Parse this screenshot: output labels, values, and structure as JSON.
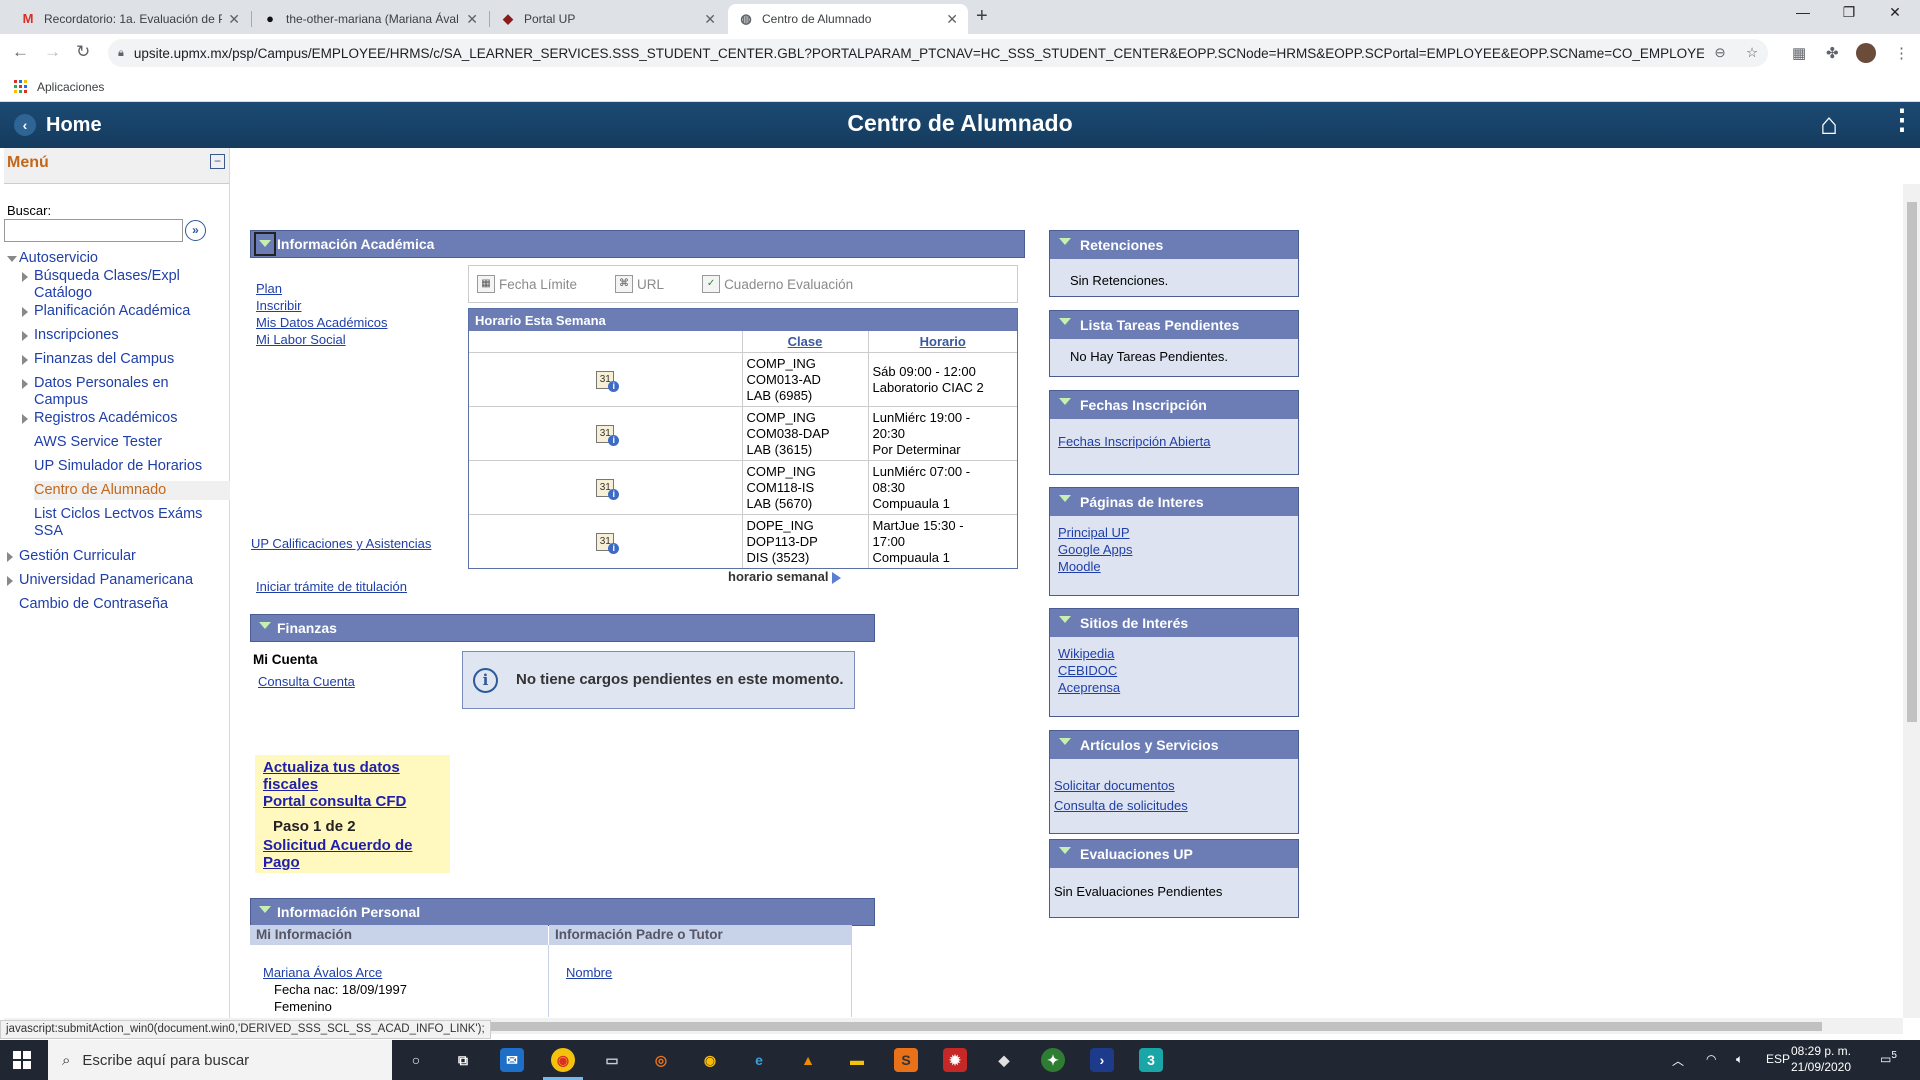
{
  "browser": {
    "tabs": [
      {
        "title": "Recordatorio: 1a. Evaluación de P",
        "favicon": "M"
      },
      {
        "title": "the-other-mariana (Mariana Ával",
        "favicon": "gh"
      },
      {
        "title": "Portal UP",
        "favicon": "up"
      },
      {
        "title": "Centro de Alumnado",
        "favicon": "globe"
      }
    ],
    "url": "upsite.upmx.mx/psp/Campus/EMPLOYEE/HRMS/c/SA_LEARNER_SERVICES.SSS_STUDENT_CENTER.GBL?PORTALPARAM_PTCNAV=HC_SSS_STUDENT_CENTER&EOPP.SCNode=HRMS&EOPP.SCPortal=EMPLOYEE&EOPP.SCName=CO_EMPLOYEE_SELF_SERV...",
    "bookmarks_label": "Aplicaciones"
  },
  "header": {
    "home_label": "Home",
    "title": "Centro de Alumnado"
  },
  "menu": {
    "title": "Menú",
    "search_label": "Buscar:",
    "autoservicio": "Autoservicio",
    "sub_items": [
      "Búsqueda Clases/Expl Catálogo",
      "Planificación Académica",
      "Inscripciones",
      "Finanzas del Campus",
      "Datos Personales en Campus",
      "Registros Académicos",
      "AWS Service Tester",
      "UP Simulador de Horarios",
      "Centro de Alumnado",
      "List Ciclos Lectvos Exáms SSA"
    ],
    "top_items": [
      "Gestión Curricular",
      "Universidad Panamericana",
      "Cambio de Contraseña"
    ]
  },
  "academica": {
    "title": "Información Académica",
    "links": [
      "Plan",
      "Inscribir",
      "Mis Datos Académicos",
      "Mi Labor Social"
    ],
    "calificaciones": "UP Calificaciones y Asistencias",
    "titulacion": "Iniciar trámite de titulación",
    "tools": [
      "Fecha Límite",
      "URL",
      "Cuaderno Evaluación"
    ],
    "schedule_title": "Horario Esta Semana",
    "col_clase": "Clase",
    "col_horario": "Horario",
    "rows": [
      {
        "clase": [
          "COMP_ING",
          "COM013-AD",
          "LAB (6985)"
        ],
        "horario": [
          "Sáb 09:00 - 12:00",
          "Laboratorio CIAC 2"
        ]
      },
      {
        "clase": [
          "COMP_ING",
          "COM038-DAP",
          "LAB (3615)"
        ],
        "horario": [
          "LunMiérc 19:00 -",
          "20:30",
          "Por Determinar"
        ]
      },
      {
        "clase": [
          "COMP_ING",
          "COM118-IS",
          "LAB (5670)"
        ],
        "horario": [
          "LunMiérc 07:00 -",
          "08:30",
          "Compuaula 1"
        ]
      },
      {
        "clase": [
          "DOPE_ING",
          "DOP113-DP",
          "DIS (3523)"
        ],
        "horario": [
          "MartJue 15:30 -",
          "17:00",
          "Compuaula 1"
        ]
      }
    ],
    "weekly_link": "horario semanal"
  },
  "finanzas": {
    "title": "Finanzas",
    "mi_cuenta": "Mi Cuenta",
    "consulta": "Consulta Cuenta",
    "message": "No tiene cargos pendientes en este momento."
  },
  "promo": {
    "actualiza": "Actualiza tus datos fiscales",
    "portal_cfd": "Portal consulta CFD",
    "paso": "Paso 1 de 2",
    "solicitud": "Solicitud Acuerdo de Pago"
  },
  "personal": {
    "title": "Información Personal",
    "mi_info": "Mi Información",
    "padre": "Información Padre o Tutor",
    "name": "Mariana Ávalos Arce",
    "fecha": "Fecha nac: 18/09/1997",
    "sexo": "Femenino",
    "nombre_link": "Nombre"
  },
  "right": {
    "retenciones": {
      "title": "Retenciones",
      "text": "Sin Retenciones."
    },
    "tareas": {
      "title": "Lista Tareas Pendientes",
      "text": "No Hay Tareas Pendientes."
    },
    "fechas": {
      "title": "Fechas Inscripción",
      "link": "Fechas Inscripción Abierta"
    },
    "paginas": {
      "title": "Páginas de Interes",
      "links": [
        "Principal UP",
        "Google Apps",
        "Moodle"
      ]
    },
    "sitios": {
      "title": "Sitios de Interés",
      "links": [
        "Wikipedia",
        "CEBIDOC",
        "Aceprensa"
      ]
    },
    "articulos": {
      "title": "Artículos y Servicios",
      "links": [
        "Solicitar documentos",
        "Consulta de solicitudes"
      ]
    },
    "evaluaciones": {
      "title": "Evaluaciones UP",
      "text": "Sin Evaluaciones Pendientes"
    }
  },
  "status_text": "javascript:submitAction_win0(document.win0,'DERIVED_SSS_SCL_SS_ACAD_INFO_LINK');",
  "taskbar": {
    "search_placeholder": "Escribe aquí para buscar",
    "lang": "ESP",
    "time": "08:29 p. m.",
    "date": "21/09/2020",
    "notif": "5"
  }
}
